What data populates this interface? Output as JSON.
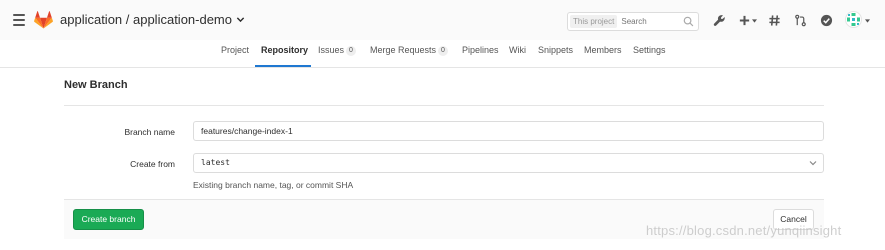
{
  "header": {
    "title": "application / application-demo",
    "search": {
      "scope_label": "This project",
      "placeholder": "Search"
    },
    "icons": [
      "menu-icon",
      "gitlab-logo",
      "chevron-down-icon",
      "search-icon",
      "wrench-icon",
      "plus-icon",
      "hash-icon",
      "merge-request-icon",
      "todo-check-icon",
      "avatar"
    ]
  },
  "tabs": [
    {
      "label": "Project"
    },
    {
      "label": "Repository",
      "active": true
    },
    {
      "label": "Issues",
      "count": "0"
    },
    {
      "label": "Merge Requests",
      "count": "0"
    },
    {
      "label": "Pipelines"
    },
    {
      "label": "Wiki"
    },
    {
      "label": "Snippets"
    },
    {
      "label": "Members"
    },
    {
      "label": "Settings"
    }
  ],
  "page": {
    "title": "New Branch"
  },
  "form": {
    "branch_name_label": "Branch name",
    "branch_name_value": "features/change-index-1",
    "create_from_label": "Create from",
    "create_from_value": "latest",
    "create_from_help": "Existing branch name, tag, or commit SHA"
  },
  "actions": {
    "create_label": "Create branch",
    "cancel_label": "Cancel"
  },
  "watermark": "https://blog.csdn.net/yunqiinsight",
  "colors": {
    "accent": "#1f78d1",
    "success": "#1aaa55",
    "logo_orange": "#e24329"
  }
}
